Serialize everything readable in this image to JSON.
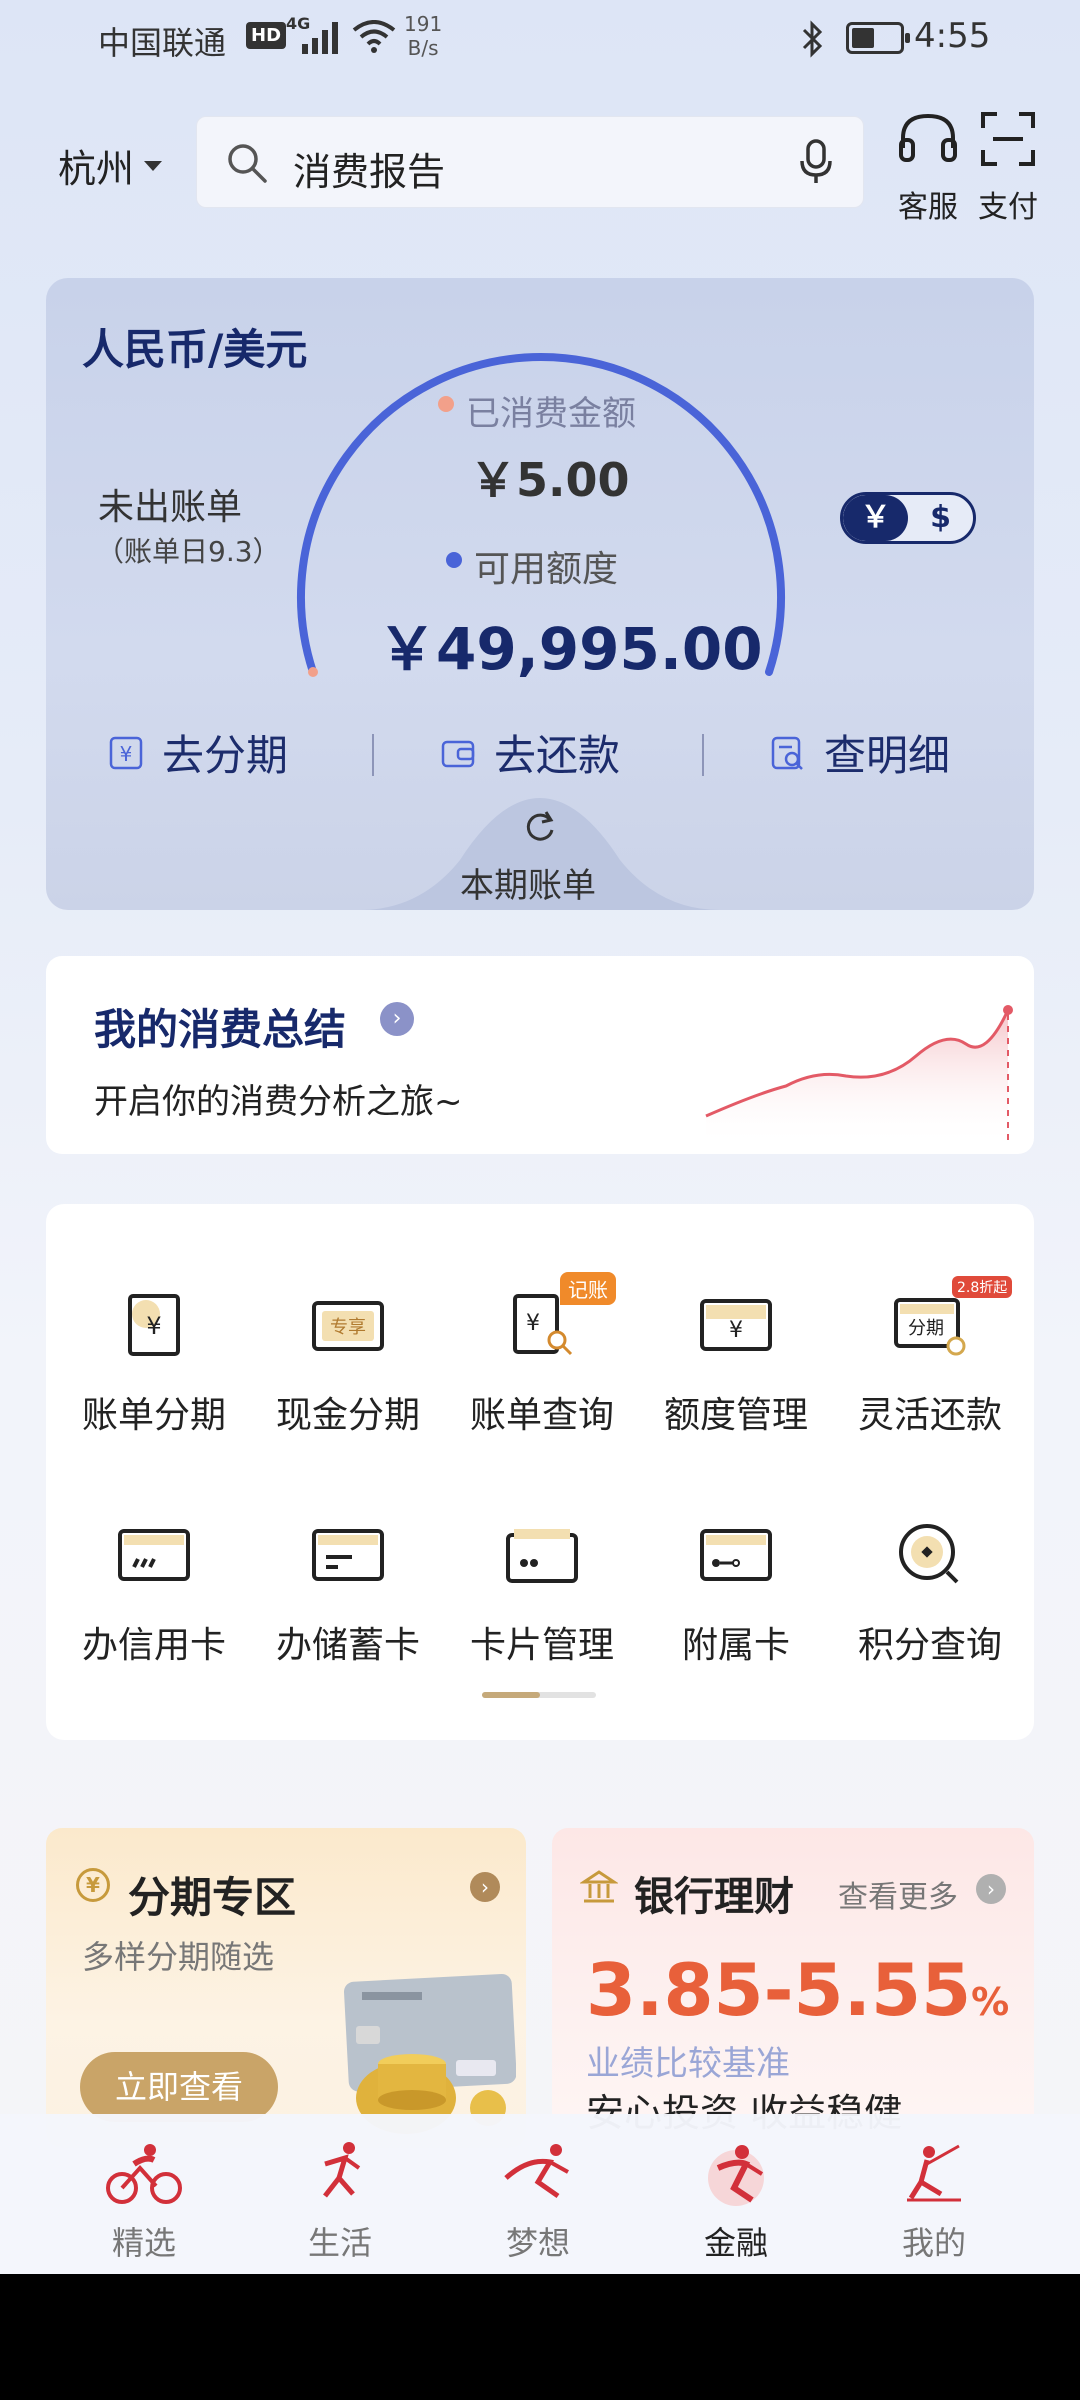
{
  "status_bar": {
    "carrier": "中国联通",
    "hd": "HD",
    "network": "4G",
    "speed_value": "191",
    "speed_unit": "B/s",
    "time": "4:55"
  },
  "header": {
    "city": "杭州",
    "search_text": "消费报告",
    "service_label": "客服",
    "pay_label": "支付"
  },
  "card": {
    "title": "人民币/美元",
    "unbilled": "未出账单",
    "bill_day": "（账单日9.3）",
    "consumed_label": "已消费金额",
    "consumed_value": "￥5.00",
    "available_label": "可用额度",
    "available_value": "￥49,995.00",
    "currency_on": "￥",
    "currency_off": "$",
    "actions": {
      "installment": "去分期",
      "repay": "去还款",
      "detail": "查明细"
    },
    "current_bill": "本期账单"
  },
  "summary": {
    "title": "我的消费总结",
    "subtitle": "开启你的消费分析之旅~"
  },
  "menu": {
    "row1": [
      {
        "label": "账单分期",
        "icon": "bill-installment-icon"
      },
      {
        "label": "现金分期",
        "icon": "cash-installment-icon",
        "tag": "专享"
      },
      {
        "label": "账单查询",
        "icon": "bill-query-icon",
        "badge": "记账"
      },
      {
        "label": "额度管理",
        "icon": "credit-limit-icon"
      },
      {
        "label": "灵活还款",
        "icon": "flexible-repay-icon",
        "tag": "分期",
        "badge": "2.8折起"
      }
    ],
    "row2": [
      {
        "label": "办信用卡",
        "icon": "apply-credit-card-icon"
      },
      {
        "label": "办储蓄卡",
        "icon": "apply-debit-card-icon"
      },
      {
        "label": "卡片管理",
        "icon": "card-management-icon"
      },
      {
        "label": "附属卡",
        "icon": "supplementary-card-icon"
      },
      {
        "label": "积分查询",
        "icon": "points-query-icon"
      }
    ],
    "page": 1,
    "pages": 2
  },
  "promo_installment": {
    "title": "分期专区",
    "subtitle": "多样分期随选",
    "button": "立即查看"
  },
  "promo_wealth": {
    "title": "银行理财",
    "more": "查看更多",
    "rate": "3.85-5.55",
    "rate_unit": "%",
    "rate_desc": "业绩比较基准",
    "slogan": "安心投资 收益稳健"
  },
  "bottom_nav": [
    {
      "label": "精选"
    },
    {
      "label": "生活"
    },
    {
      "label": "梦想"
    },
    {
      "label": "金融"
    },
    {
      "label": "我的"
    }
  ],
  "colors": {
    "brand_navy": "#17296b",
    "accent_red": "#d2303a",
    "gold": "#c9a468",
    "rate_orange": "#e8603a"
  }
}
